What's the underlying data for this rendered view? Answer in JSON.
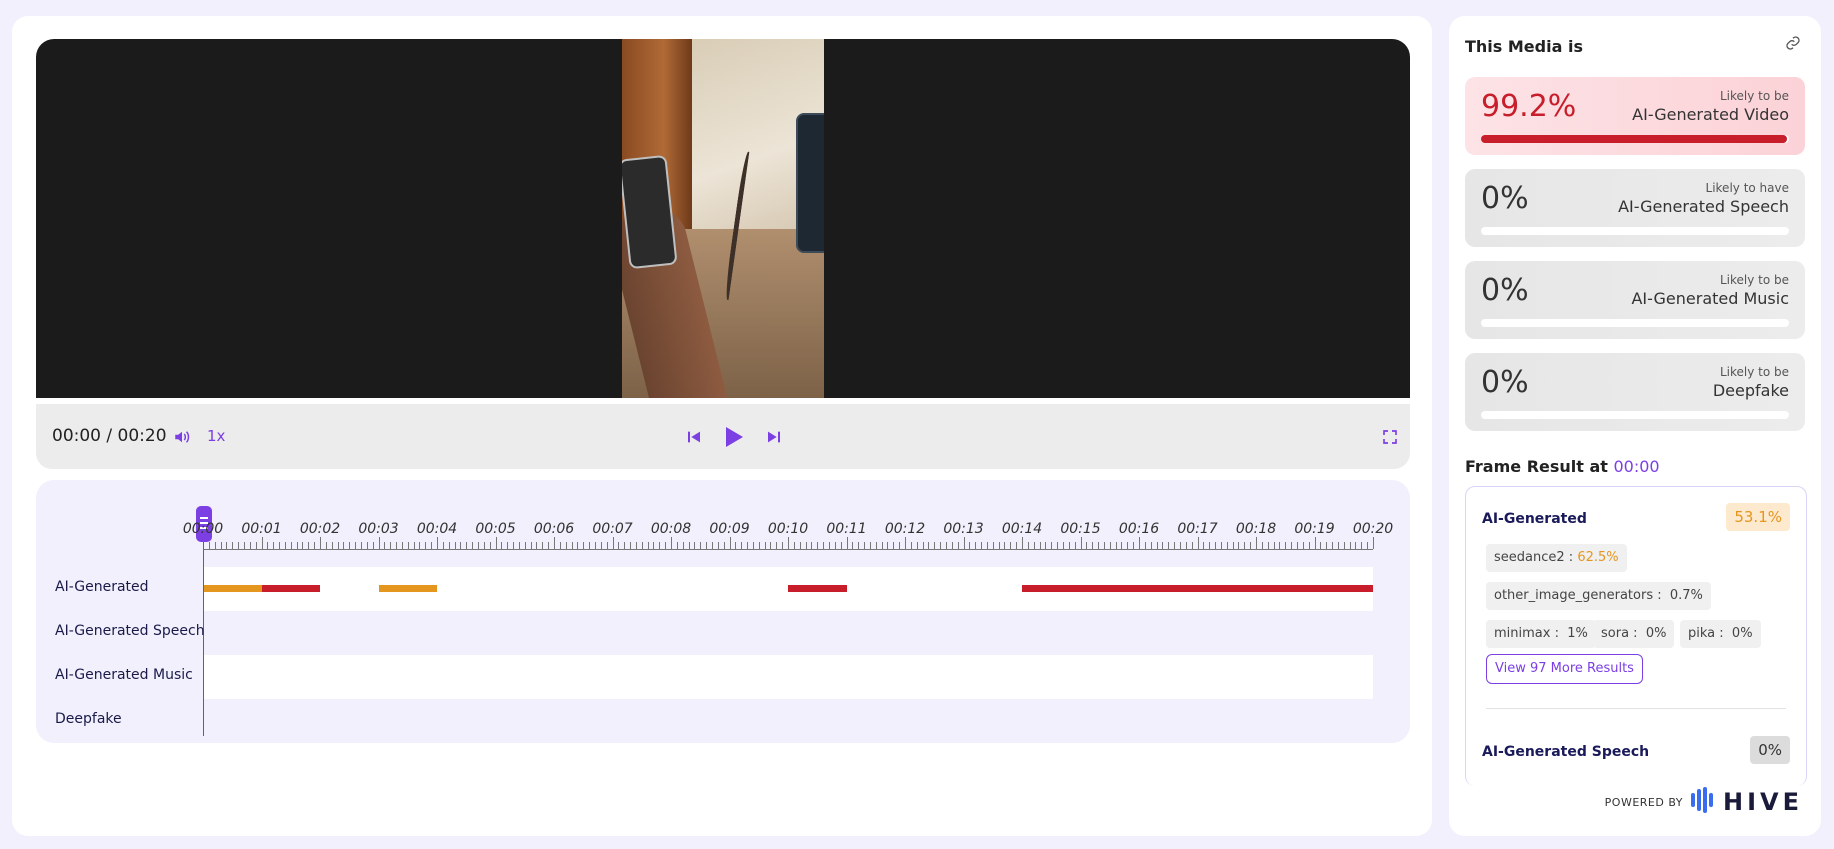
{
  "player": {
    "time": "00:00 / 00:20",
    "speed": "1x"
  },
  "timeline": {
    "ticks": [
      "00:00",
      "00:01",
      "00:02",
      "00:03",
      "00:04",
      "00:05",
      "00:06",
      "00:07",
      "00:08",
      "00:09",
      "00:10",
      "00:11",
      "00:12",
      "00:13",
      "00:14",
      "00:15",
      "00:16",
      "00:17",
      "00:18",
      "00:19",
      "00:20"
    ],
    "rows": [
      {
        "label": "AI-Generated",
        "segments": [
          {
            "start": 0,
            "end": 1,
            "color": "#e5961f"
          },
          {
            "start": 1,
            "end": 2,
            "color": "#c81d2a"
          },
          {
            "start": 3,
            "end": 4,
            "color": "#e5961f"
          },
          {
            "start": 10,
            "end": 11,
            "color": "#c81d2a"
          },
          {
            "start": 14,
            "end": 20,
            "color": "#c81d2a"
          }
        ]
      },
      {
        "label": "AI-Generated Speech",
        "segments": []
      },
      {
        "label": "AI-Generated Music",
        "segments": []
      },
      {
        "label": "Deepfake",
        "segments": []
      }
    ]
  },
  "panel": {
    "title": "This Media is",
    "cards": [
      {
        "value": "99.2%",
        "sub": "Likely to be",
        "name": "AI-Generated Video",
        "fill": 0.992
      },
      {
        "value": "0%",
        "sub": "Likely to have",
        "name": "AI-Generated Speech",
        "fill": 0
      },
      {
        "value": "0%",
        "sub": "Likely to be",
        "name": "AI-Generated Music",
        "fill": 0
      },
      {
        "value": "0%",
        "sub": "Likely to be",
        "name": "Deepfake",
        "fill": 0
      }
    ],
    "frame_result_label": "Frame Result at",
    "frame_result_time": "00:00",
    "frame": {
      "ai_label": "AI-Generated",
      "ai_score": "53.1%",
      "chips": [
        {
          "name": "seedance2",
          "value": "62.5%"
        },
        {
          "name": "other_image_generators",
          "value": "0.7%"
        },
        {
          "name": "minimax",
          "value": "1%"
        },
        {
          "name": "sora",
          "value": "0%"
        },
        {
          "name": "pika",
          "value": "0%"
        }
      ],
      "more_button": "View 97 More Results",
      "speech_label": "AI-Generated Speech",
      "speech_score": "0%"
    },
    "powered_by": "POWERED BY",
    "brand": "HIVE"
  },
  "colors": {
    "accent": "#7b3fe4",
    "danger": "#c81d2a",
    "warning": "#e5961f"
  }
}
